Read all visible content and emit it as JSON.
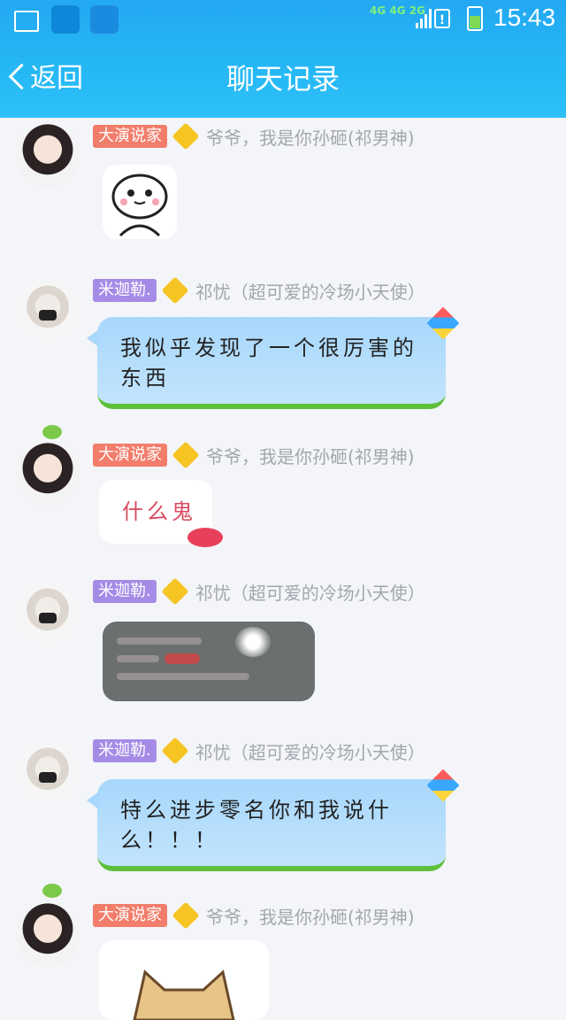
{
  "status_bar": {
    "time": "15:43",
    "network": "4G 4G 2G",
    "alert": "!"
  },
  "header": {
    "back_label": "返回",
    "title": "聊天记录"
  },
  "messages": [
    {
      "badge": "大演说家",
      "nick": "爷爷，我是你孙砸(祁男神)",
      "type": "sticker"
    },
    {
      "badge": "米迦勒.",
      "nick": "祁忧（超可爱的冷场小天使）",
      "type": "text",
      "text": "我似乎发现了一个很厉害的东西"
    },
    {
      "badge": "大演说家",
      "nick": "爷爷，我是你孙砸(祁男神)",
      "type": "text",
      "text": "什么鬼"
    },
    {
      "badge": "米迦勒.",
      "nick": "祁忧（超可爱的冷场小天使）",
      "type": "image"
    },
    {
      "badge": "米迦勒.",
      "nick": "祁忧（超可爱的冷场小天使）",
      "type": "text",
      "text": "特么进步零名你和我说什么！！！"
    },
    {
      "badge": "大演说家",
      "nick": "爷爷，我是你孙砸(祁男神)",
      "type": "sticker"
    }
  ]
}
